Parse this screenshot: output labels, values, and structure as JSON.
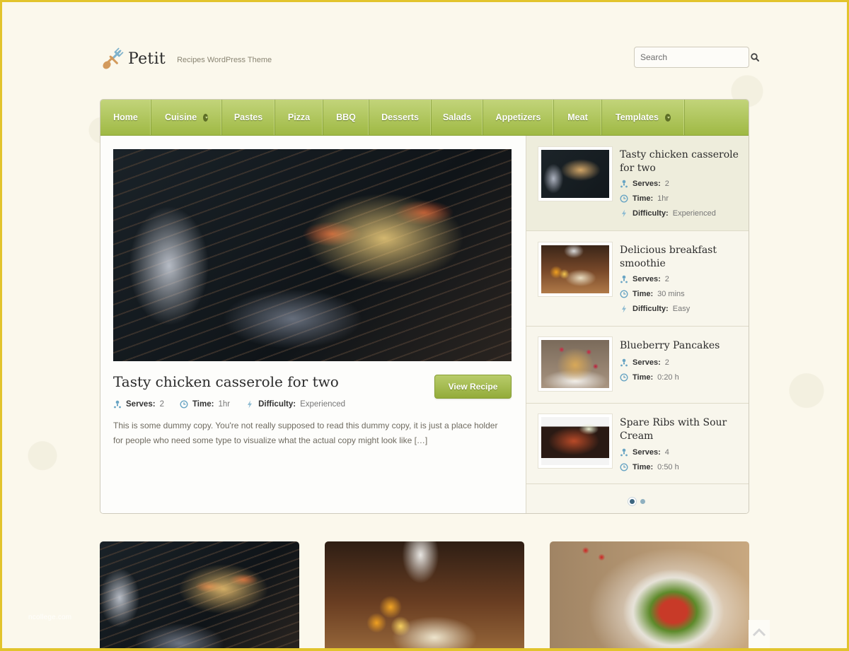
{
  "site": {
    "title": "Petit",
    "tagline": "Recipes WordPress Theme",
    "logo_icon": "fork-spoon-icon"
  },
  "search": {
    "placeholder": "Search",
    "value": "",
    "icon": "search-icon"
  },
  "nav": {
    "items": [
      {
        "label": "Home",
        "has_dropdown": false
      },
      {
        "label": "Cuisine",
        "has_dropdown": true
      },
      {
        "label": "Pastes",
        "has_dropdown": false
      },
      {
        "label": "Pizza",
        "has_dropdown": false
      },
      {
        "label": "BBQ",
        "has_dropdown": false
      },
      {
        "label": "Desserts",
        "has_dropdown": false
      },
      {
        "label": "Salads",
        "has_dropdown": false
      },
      {
        "label": "Appetizers",
        "has_dropdown": false
      },
      {
        "label": "Meat",
        "has_dropdown": false
      },
      {
        "label": "Templates",
        "has_dropdown": true
      }
    ]
  },
  "featured": {
    "title": "Tasty chicken casserole for two",
    "button_label": "View Recipe",
    "serves_label": "Serves:",
    "serves": "2",
    "time_label": "Time:",
    "time": "1hr",
    "difficulty_label": "Difficulty:",
    "difficulty": "Experienced",
    "excerpt": "This is some dummy copy. You're not really supposed to read this dummy copy, it is just a place holder for people who need some type to visualize what the actual copy might look like […]"
  },
  "sidebar": {
    "items": [
      {
        "title": "Tasty chicken casserole for two",
        "serves_label": "Serves:",
        "serves": "2",
        "time_label": "Time:",
        "time": "1hr",
        "difficulty_label": "Difficulty:",
        "difficulty": "Experienced",
        "active": true
      },
      {
        "title": "Delicious breakfast smoothie",
        "serves_label": "Serves:",
        "serves": "2",
        "time_label": "Time:",
        "time": "30 mins",
        "difficulty_label": "Difficulty:",
        "difficulty": "Easy",
        "active": false
      },
      {
        "title": "Blueberry Pancakes",
        "serves_label": "Serves:",
        "serves": "2",
        "time_label": "Time:",
        "time": "0:20 h",
        "active": false
      },
      {
        "title": "Spare Ribs with Sour Cream",
        "serves_label": "Serves:",
        "serves": "4",
        "time_label": "Time:",
        "time": "0:50 h",
        "active": false
      }
    ],
    "pagination": {
      "pages": 2,
      "current": 1
    }
  },
  "cards": [
    {
      "image": "chicken-casserole-photo"
    },
    {
      "image": "breakfast-smoothie-ingredients-photo"
    },
    {
      "image": "greek-salad-photo"
    }
  ],
  "watermark": "ncollege.com",
  "colors": {
    "accent_green": "#a3bc48",
    "frame_yellow": "#e2c42c",
    "icon_blue": "#6aa5c4"
  }
}
